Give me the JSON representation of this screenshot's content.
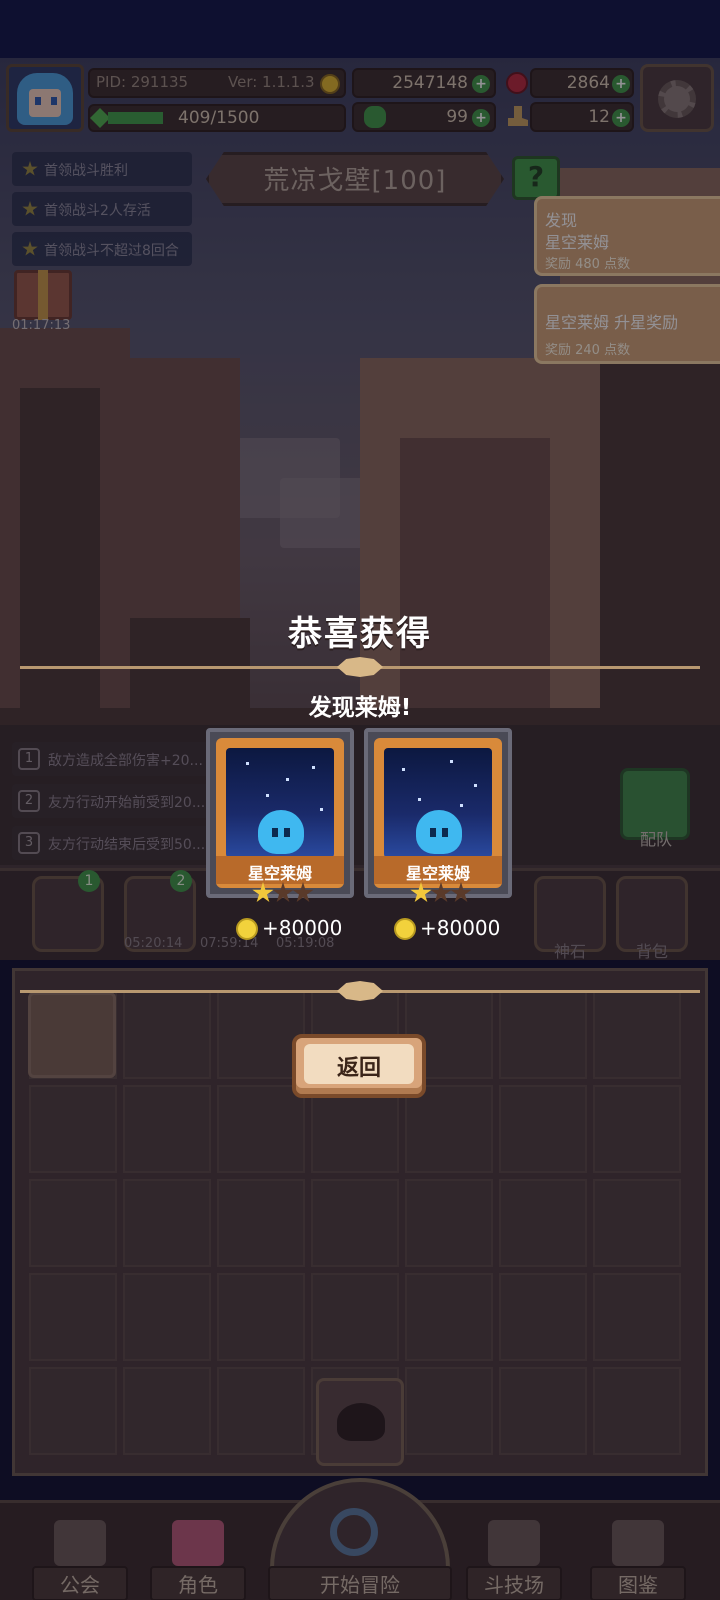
{
  "player": {
    "pid": "PID: 291135",
    "version": "Ver: 1.1.1.3",
    "gold": "2547148",
    "gems": "2864",
    "stamina": "409/1500",
    "clover": "99",
    "boots": "12"
  },
  "quests": [
    "首领战斗胜利",
    "首领战斗2人存活",
    "首领战斗不超过8回合"
  ],
  "gift_timer": "01:17:13",
  "stage": {
    "title": "荒凉戈壁[100]",
    "help_label": "帮"
  },
  "notifications": [
    {
      "line1": "发现",
      "line2": "星空莱姆",
      "line3": "奖励 480 点数"
    },
    {
      "line1": "星空莱姆 升星奖励",
      "line3": "奖励 240 点数"
    }
  ],
  "effects": [
    {
      "num": "1",
      "text": "敌方造成全部伤害+20..."
    },
    {
      "num": "2",
      "text": "友方行动开始前受到20..."
    },
    {
      "num": "3",
      "text": "友方行动结束后受到50..."
    }
  ],
  "team_label": "配队",
  "slots": {
    "badges": [
      "1",
      "2"
    ],
    "timers": [
      "05:20:14",
      "07:59:14",
      "05:19:08"
    ],
    "labels": [
      "神石",
      "背包"
    ]
  },
  "popup": {
    "title": "恭喜获得",
    "subtitle": "发现莱姆!",
    "cards": [
      {
        "name": "星空莱姆",
        "reward": "+80000",
        "stars": 1
      },
      {
        "name": "星空莱姆",
        "reward": "+80000",
        "stars": 1
      }
    ],
    "return_label": "返回"
  },
  "nav": {
    "guild": "公会",
    "character": "角色",
    "adventure": "开始冒险",
    "arena": "斗技场",
    "codex": "图鉴"
  },
  "colors": {
    "accent_green": "#3f9a48",
    "notif_bg": "#cfa277",
    "card_orange": "#d98a3a",
    "slime_blue": "#3fb8f0"
  }
}
